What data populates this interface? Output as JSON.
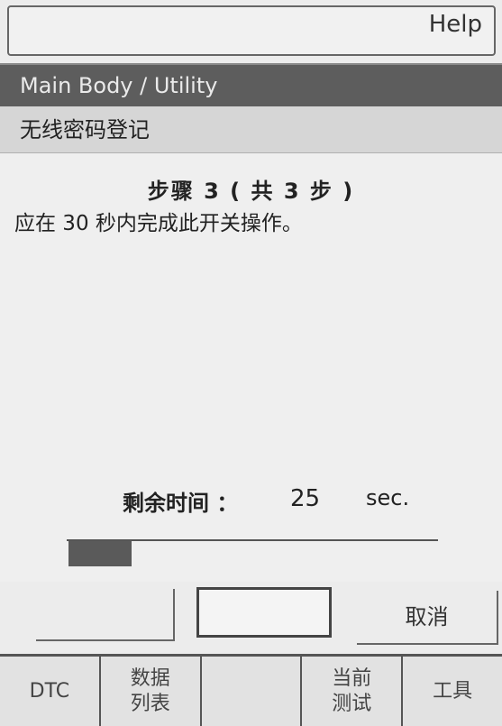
{
  "header": {
    "help_label": "Help"
  },
  "breadcrumb": "Main Body / Utility",
  "screen_title": "无线密码登记",
  "step_label": "步骤 3 ( 共 3 步 )",
  "instruction": "应在 30 秒内完成此开关操作。",
  "timer": {
    "label": "剩余时间 ：",
    "value": "25",
    "unit": "sec."
  },
  "progress": {
    "fraction": 0.17
  },
  "buttons": {
    "cancel_label": "取消"
  },
  "tabs": [
    {
      "label": "DTC"
    },
    {
      "label": "数据\n列表"
    },
    {
      "label": ""
    },
    {
      "label": "当前\n测试"
    },
    {
      "label": "工具"
    }
  ]
}
